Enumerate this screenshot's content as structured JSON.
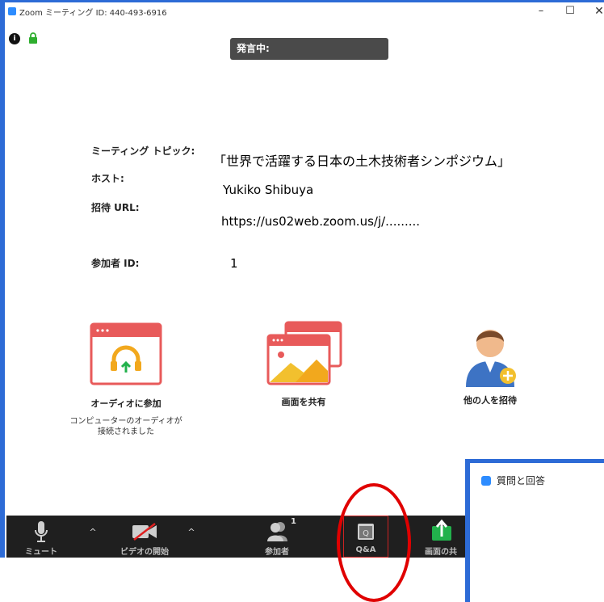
{
  "window": {
    "title": "Zoom ミーティング ID: 440-493-6916",
    "minimize": "–",
    "maximize": "☐",
    "close": "✕"
  },
  "status": {
    "info_icon_text": "i",
    "speaking_label": "発言中:"
  },
  "meeting_info": {
    "topic_label": "ミーティング トピック:",
    "topic_value": "「世界で活躍する日本の土木技術者シンポジウム」",
    "host_label": "ホスト:",
    "host_value": "Yukiko Shibuya",
    "invite_url_label": "招待 URL:",
    "invite_url_value": "https://us02web.zoom.us/j/.........",
    "participant_id_label": "参加者 ID:",
    "participant_id_value": "1"
  },
  "actions": {
    "join_audio_label": "オーディオに参加",
    "join_audio_sub_line1": "コンピューターのオーディオが",
    "join_audio_sub_line2": "接続されました",
    "share_screen_label": "画面を共有",
    "invite_label": "他の人を招待"
  },
  "toolbar": {
    "mute_label": "ミュート",
    "video_label": "ビデオの開始",
    "participants_label": "参加者",
    "participants_count": "1",
    "qa_label": "Q&A",
    "share_label": "画面の共"
  },
  "qa_panel": {
    "title": "質問と回答"
  },
  "colors": {
    "accent_blue": "#2d6bd6",
    "zoom_blue": "#2d8cff",
    "toolbar_bg": "#1f1f1f",
    "highlight_red": "#e00000",
    "share_green": "#22b14c"
  }
}
